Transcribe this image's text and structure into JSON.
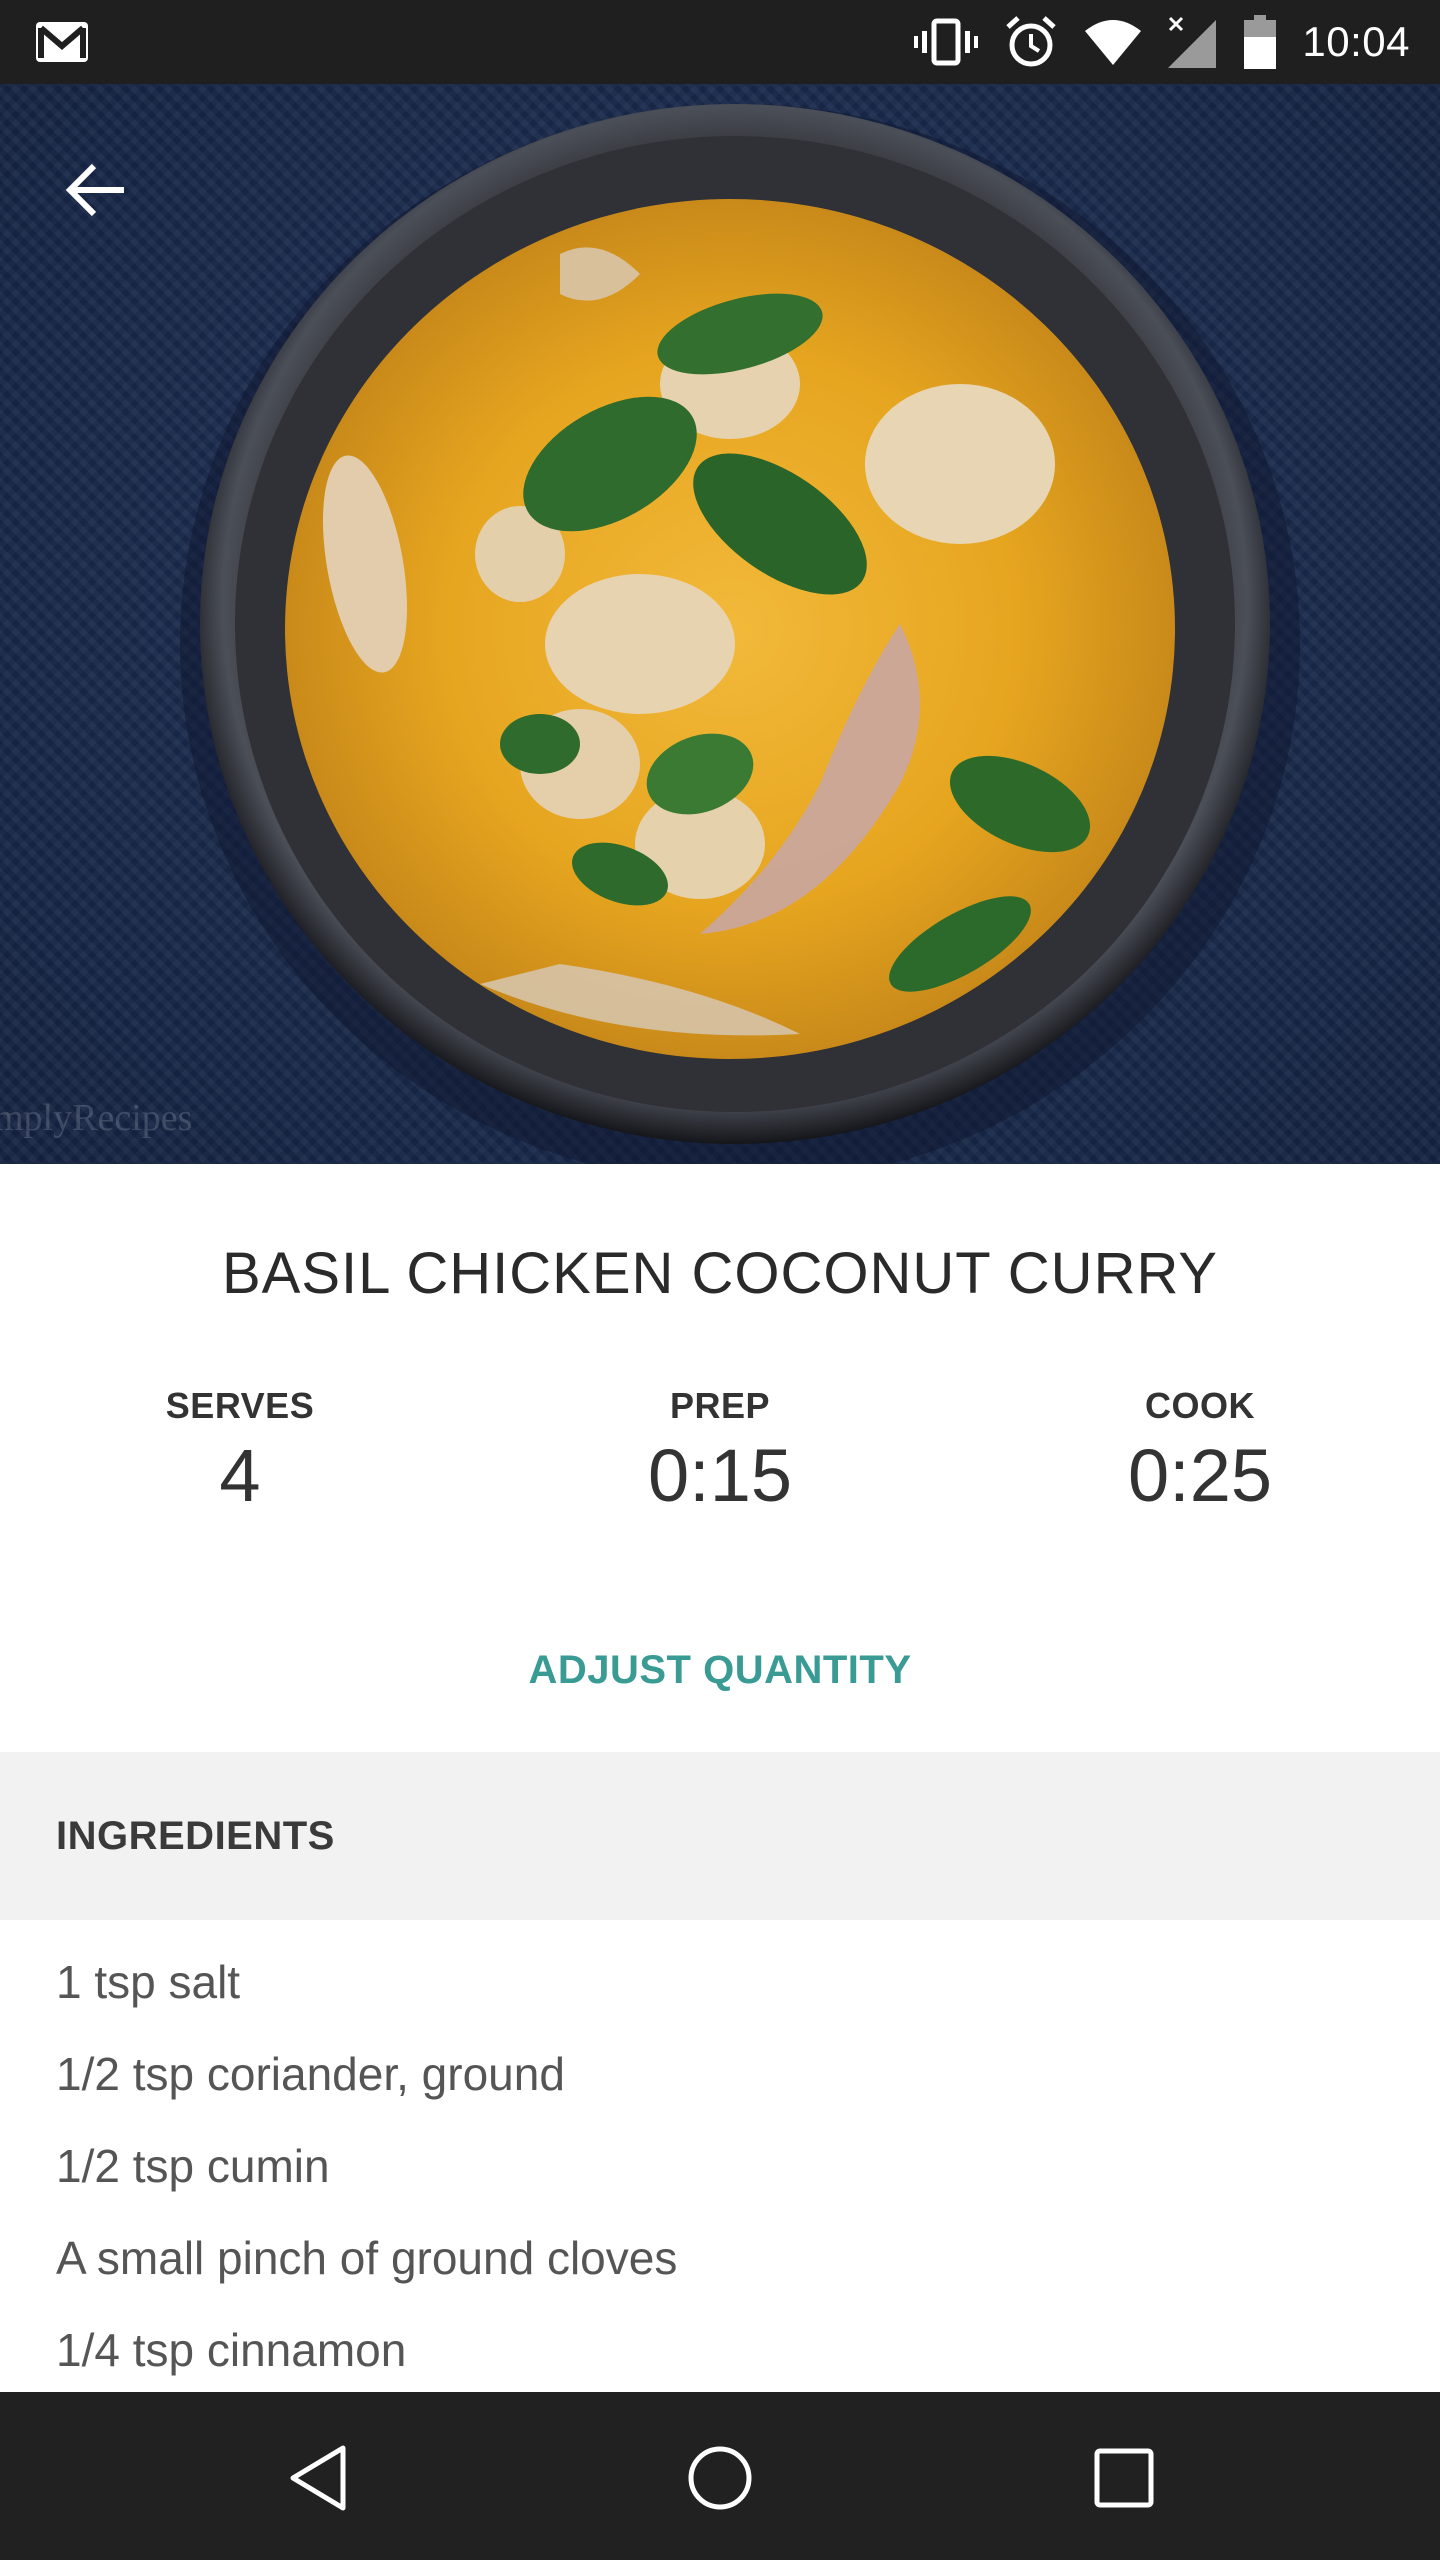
{
  "status_bar": {
    "time": "10:04",
    "icons": [
      "gmail-icon",
      "vibrate-icon",
      "alarm-icon",
      "wifi-icon",
      "signal-icon",
      "battery-icon"
    ]
  },
  "hero": {
    "watermark": "mplyRecipes",
    "back_icon": "arrow-back-icon"
  },
  "recipe": {
    "title": "BASIL CHICKEN COCONUT CURRY",
    "serves_label": "SERVES",
    "serves_value": "4",
    "prep_label": "PREP",
    "prep_value": "0:15",
    "cook_label": "COOK",
    "cook_value": "0:25",
    "adjust_label": "ADJUST QUANTITY"
  },
  "ingredients": {
    "header": "INGREDIENTS",
    "items": [
      "1 tsp salt",
      "1/2 tsp coriander, ground",
      "1/2 tsp cumin",
      "A small pinch of ground cloves",
      "1/4 tsp cinnamon"
    ]
  },
  "nav_bar": {
    "icons": [
      "nav-back-icon",
      "nav-home-icon",
      "nav-recents-icon"
    ]
  },
  "colors": {
    "accent": "#3a9b95",
    "status_bar": "#1f1f1f",
    "nav_bar": "#212121",
    "section_bg": "#f2f2f2"
  }
}
